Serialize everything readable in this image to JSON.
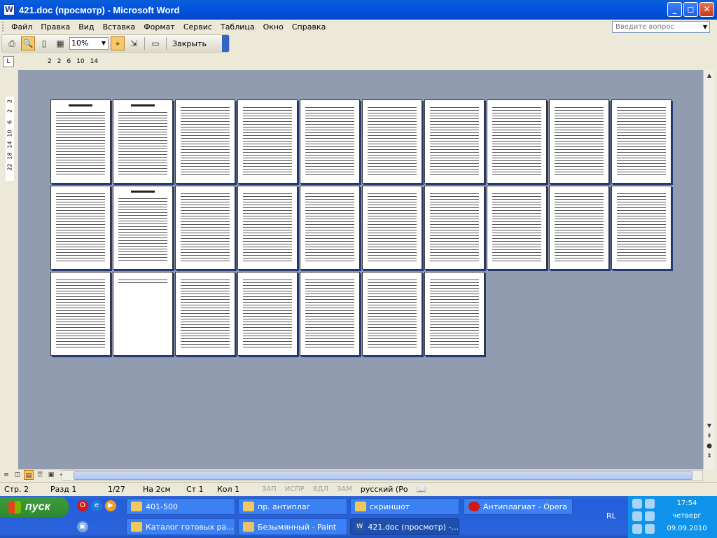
{
  "window": {
    "title": "421.doc (просмотр) - Microsoft Word",
    "app_icon": "W",
    "min_label": "_",
    "max_label": "◻",
    "close_label": "✕"
  },
  "menu": {
    "items": [
      "Файл",
      "Правка",
      "Вид",
      "Вставка",
      "Формат",
      "Сервис",
      "Таблица",
      "Окно",
      "Справка"
    ],
    "ask_placeholder": "Введите вопрос"
  },
  "toolbar": {
    "zoom": "10%",
    "close_label": "Закрыть"
  },
  "ruler": {
    "marks": [
      "2",
      "2",
      "6",
      "10",
      "14"
    ],
    "tab_label": "L"
  },
  "vruler": {
    "marks": [
      "2",
      "2",
      "6",
      "10",
      "14",
      "18",
      "22"
    ]
  },
  "document": {
    "page_count": 27,
    "rows": 3,
    "columns": 10
  },
  "status": {
    "page": "Стр. 2",
    "section": "Разд 1",
    "pages": "1/27",
    "at": "На 2см",
    "line": "Ст 1",
    "col": "Кол 1",
    "rec": "ЗАП",
    "trk": "ИСПР",
    "ext": "ВДЛ",
    "ovr": "ЗАМ",
    "language": "русский (Ро"
  },
  "taskbar": {
    "start_label": "пуск",
    "tasks_top": [
      {
        "label": "401-500",
        "icon": "folder-icon"
      },
      {
        "label": "пр. антиплаг",
        "icon": "folder-icon"
      },
      {
        "label": "скриншот",
        "icon": "folder-icon"
      },
      {
        "label": "Антиплагиат - Opera",
        "icon": "opera-icon"
      }
    ],
    "tasks_bottom": [
      {
        "label": "Каталог готовых ра...",
        "icon": "folder-icon"
      },
      {
        "label": "Безымянный - Paint",
        "icon": "paint-icon"
      },
      {
        "label": "421.doc (просмотр) -...",
        "icon": "word-icon"
      }
    ],
    "lang": "RL",
    "time": "17:54",
    "day": "четверг",
    "date": "09.09.2010"
  }
}
